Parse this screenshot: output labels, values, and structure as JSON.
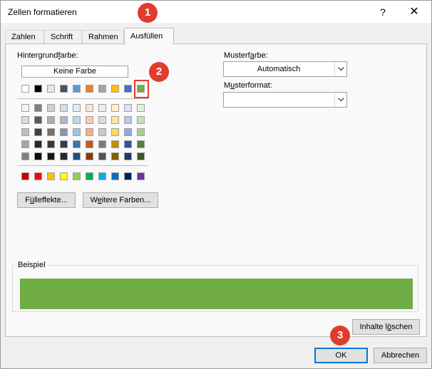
{
  "window": {
    "title": "Zellen formatieren",
    "help_glyph": "?",
    "close_glyph": "✕"
  },
  "tabs": [
    {
      "label": "Zahlen",
      "active": false
    },
    {
      "label": "Schrift",
      "active": false
    },
    {
      "label": "Rahmen",
      "active": false
    },
    {
      "label": "Ausfüllen",
      "active": true
    }
  ],
  "background": {
    "label_pre": "Hintergrund",
    "label_u": "f",
    "label_post": "arbe:",
    "no_color": "Keine Farbe",
    "theme_row": [
      "#ffffff",
      "#000000",
      "#e7e6e6",
      "#44546a",
      "#5b9bd5",
      "#ed7d31",
      "#a5a5a5",
      "#ffc000",
      "#4472c4",
      "#70ad47"
    ],
    "tints": [
      [
        "#f2f2f2",
        "#7f7f7f",
        "#d0cece",
        "#d6dce4",
        "#deebf7",
        "#fbe5d6",
        "#ededed",
        "#fff2cc",
        "#dae3f3",
        "#e2f0d9"
      ],
      [
        "#d9d9d9",
        "#595959",
        "#aeabab",
        "#adb9ca",
        "#bdd7ee",
        "#f8cbad",
        "#dbdbdb",
        "#ffe699",
        "#b4c7e7",
        "#c5e0b4"
      ],
      [
        "#bfbfbf",
        "#404040",
        "#757171",
        "#8497b0",
        "#9dc3e6",
        "#f4b183",
        "#c9c9c9",
        "#ffd966",
        "#8faadc",
        "#a9d18e"
      ],
      [
        "#a6a6a6",
        "#262626",
        "#3a3838",
        "#333f50",
        "#2e75b6",
        "#c55a11",
        "#7b7b7b",
        "#bf9000",
        "#2f5597",
        "#538135"
      ],
      [
        "#7f7f7f",
        "#0d0d0d",
        "#171616",
        "#222a35",
        "#1f4e79",
        "#843c0c",
        "#525252",
        "#7f6000",
        "#203864",
        "#375623"
      ]
    ],
    "standard_row": [
      "#c00000",
      "#ff0000",
      "#ffc000",
      "#ffff00",
      "#92d050",
      "#00b050",
      "#00b0f0",
      "#0070c0",
      "#002060",
      "#7030a0"
    ],
    "selected_color": "#70ad47"
  },
  "buttons": {
    "fill_effects_pre": "F",
    "fill_effects_u": "ü",
    "fill_effects_post": "lleffekte...",
    "more_colors_pre": "W",
    "more_colors_u": "e",
    "more_colors_post": "itere Farben...",
    "clear_pre": "Inhalte l",
    "clear_u": "ö",
    "clear_post": "schen",
    "ok": "OK",
    "cancel": "Abbrechen"
  },
  "pattern": {
    "color_label_pre": "Musterf",
    "color_label_u": "a",
    "color_label_post": "rbe:",
    "color_value": "Automatisch",
    "style_label_pre": "M",
    "style_label_u": "u",
    "style_label_post": "sterformat:",
    "style_value": ""
  },
  "sample": {
    "label": "Beispiel",
    "color": "#70ad47"
  },
  "annotations": {
    "badge1": "1",
    "badge2": "2",
    "badge3": "3",
    "color": "#e03c2d"
  }
}
